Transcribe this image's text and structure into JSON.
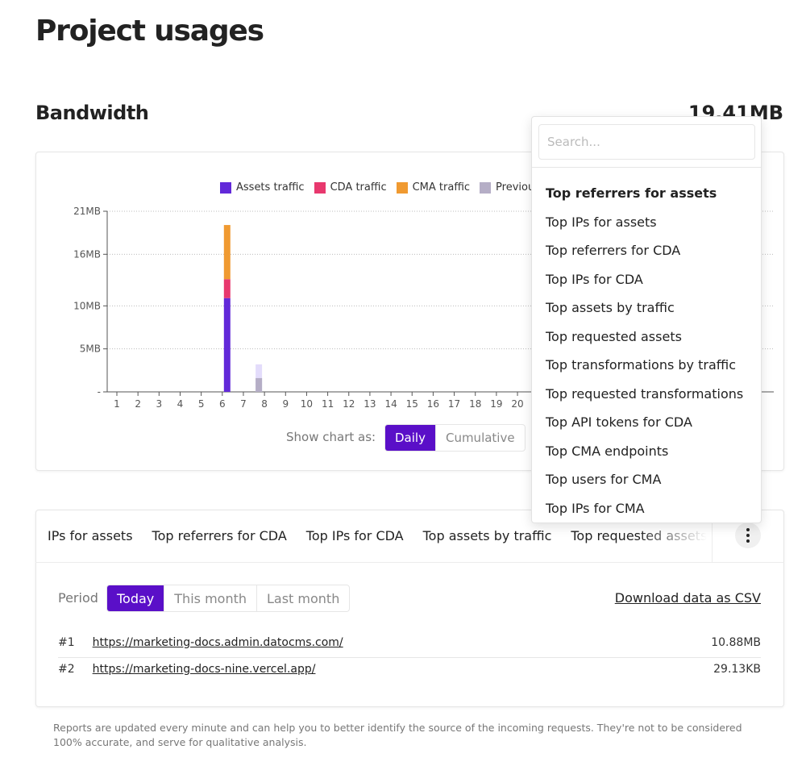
{
  "page_title": "Project usages",
  "bandwidth": {
    "title": "Bandwidth",
    "total": "19.41MB"
  },
  "colors": {
    "accent": "#5a0fc8",
    "assets": "#6229d9",
    "cda": "#e8386e",
    "cma": "#f09a31",
    "previous": "#b5aec6",
    "previous_light": "#e3dcfb"
  },
  "chart_data": {
    "type": "bar",
    "stacked": true,
    "categories": [
      "1",
      "2",
      "3",
      "4",
      "5",
      "6",
      "7",
      "8",
      "9",
      "10",
      "11",
      "12",
      "13",
      "14",
      "15",
      "16",
      "17",
      "18",
      "19",
      "20"
    ],
    "series": [
      {
        "name": "Assets traffic",
        "values": [
          0,
          0,
          0,
          0,
          0,
          10.9,
          0,
          0,
          0,
          0,
          0,
          0,
          0,
          0,
          0,
          0,
          0,
          0,
          0,
          0
        ]
      },
      {
        "name": "CDA traffic",
        "values": [
          0,
          0,
          0,
          0,
          0,
          2.2,
          0,
          0,
          0,
          0,
          0,
          0,
          0,
          0,
          0,
          0,
          0,
          0,
          0,
          0
        ]
      },
      {
        "name": "CMA traffic",
        "values": [
          0,
          0,
          0,
          0,
          0,
          6.3,
          0,
          0,
          0,
          0,
          0,
          0,
          0,
          0,
          0,
          0,
          0,
          0,
          0,
          0
        ]
      },
      {
        "name": "Previous period",
        "values": [
          0,
          0,
          0,
          0,
          0,
          0,
          0,
          3.2,
          0,
          0,
          0,
          0,
          0,
          0,
          0,
          0,
          0,
          0,
          0,
          0
        ]
      }
    ],
    "yticks": [
      "-",
      "5MB",
      "10MB",
      "16MB",
      "21MB"
    ],
    "ytick_values": [
      0,
      5,
      10,
      16,
      21
    ],
    "ylim": [
      0,
      21
    ],
    "grid": true,
    "legend": "top"
  },
  "chart_toggle": {
    "label": "Show chart as:",
    "options": [
      "Daily",
      "Cumulative"
    ],
    "selected": "Daily"
  },
  "report_tabs": [
    "IPs for assets",
    "Top referrers for CDA",
    "Top IPs for CDA",
    "Top assets by traffic",
    "Top requested assets"
  ],
  "period": {
    "label": "Period",
    "options": [
      "Today",
      "This month",
      "Last month"
    ],
    "selected": "Today"
  },
  "download_label": "Download data as CSV",
  "rows": [
    {
      "rank": "#1",
      "url": "https://marketing-docs.admin.datocms.com/",
      "value": "10.88MB"
    },
    {
      "rank": "#2",
      "url": "https://marketing-docs-nine.vercel.app/",
      "value": "29.13KB"
    }
  ],
  "footnote": "Reports are updated every minute and can help you to better identify the source of the incoming requests. They're not to be considered 100% accurate, and serve for qualitative analysis.",
  "dropdown": {
    "search_placeholder": "Search...",
    "items": [
      "Top referrers for assets",
      "Top IPs for assets",
      "Top referrers for CDA",
      "Top IPs for CDA",
      "Top assets by traffic",
      "Top requested assets",
      "Top transformations by traffic",
      "Top requested transformations",
      "Top API tokens for CDA",
      "Top CMA endpoints",
      "Top users for CMA",
      "Top IPs for CMA"
    ],
    "selected": "Top referrers for assets"
  }
}
